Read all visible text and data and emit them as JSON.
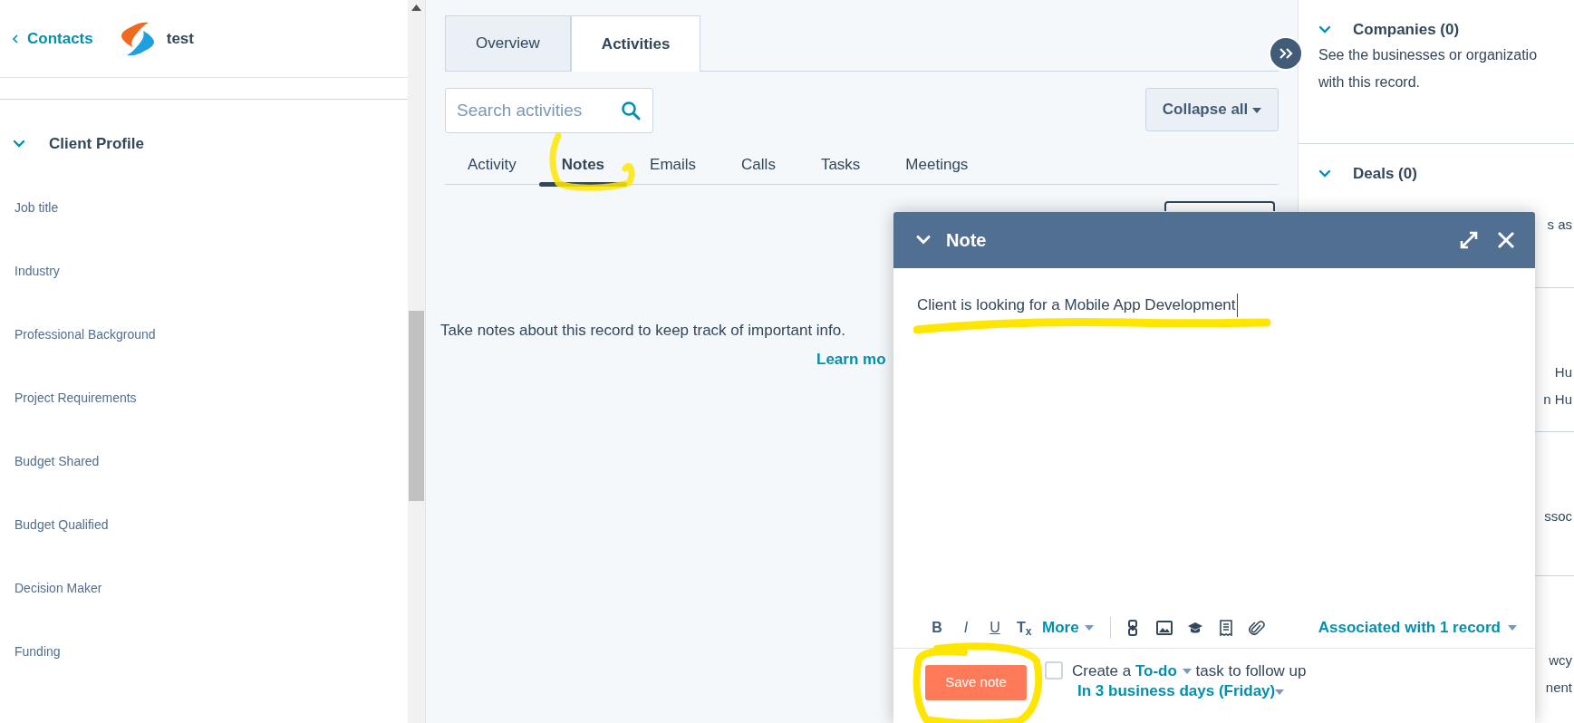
{
  "left_panel": {
    "back_link": "Contacts",
    "record_name": "test",
    "section": {
      "title": "Client Profile",
      "expanded": true,
      "fields": [
        "Job title",
        "Industry",
        "Professional Background",
        "Project Requirements",
        "Budget Shared",
        "Budget Qualified",
        "Decision Maker",
        "Funding"
      ]
    }
  },
  "tabs": [
    {
      "label": "Overview",
      "selected": false
    },
    {
      "label": "Activities",
      "selected": true
    }
  ],
  "search": {
    "placeholder": "Search activities"
  },
  "collapse_button": "Collapse all",
  "activity_tabs": [
    {
      "label": "Activity",
      "selected": false,
      "highlighted": false
    },
    {
      "label": "Notes",
      "selected": true,
      "highlighted": true
    },
    {
      "label": "Emails",
      "selected": false,
      "highlighted": false
    },
    {
      "label": "Calls",
      "selected": false,
      "highlighted": false
    },
    {
      "label": "Tasks",
      "selected": false,
      "highlighted": false
    },
    {
      "label": "Meetings",
      "selected": false,
      "highlighted": false
    }
  ],
  "empty_state": {
    "text": "Take notes about this record to keep track of important info.",
    "link": "Learn mo"
  },
  "note": {
    "title": "Note",
    "body": "Client is looking for a Mobile App Development",
    "body_highlighted": true,
    "format_buttons": [
      "B",
      "I",
      "U",
      "T$_{x}$"
    ],
    "more": "More",
    "associated": "Associated with 1 record",
    "save_button": {
      "label": "Save note",
      "highlighted": true
    },
    "follow_up": {
      "checked": false,
      "prefix": "Create a",
      "task_type": "To-do",
      "suffix": "task to follow up",
      "due": "In 3 business days (Friday)"
    }
  },
  "right_panel": {
    "sections": [
      {
        "title": "Companies (0)",
        "expanded": true,
        "lines": [
          "See the businesses or organizatio",
          "with this record."
        ]
      },
      {
        "title": "Deals (0)",
        "expanded": true,
        "covered": true,
        "lines": [
          "s as"
        ]
      },
      {
        "covered": true,
        "lines": [
          "Hu",
          "n Hu"
        ]
      },
      {
        "covered": true,
        "lines": [
          "ssoc"
        ]
      },
      {
        "covered": true,
        "lines": [
          "wcy",
          "nent"
        ]
      }
    ]
  }
}
